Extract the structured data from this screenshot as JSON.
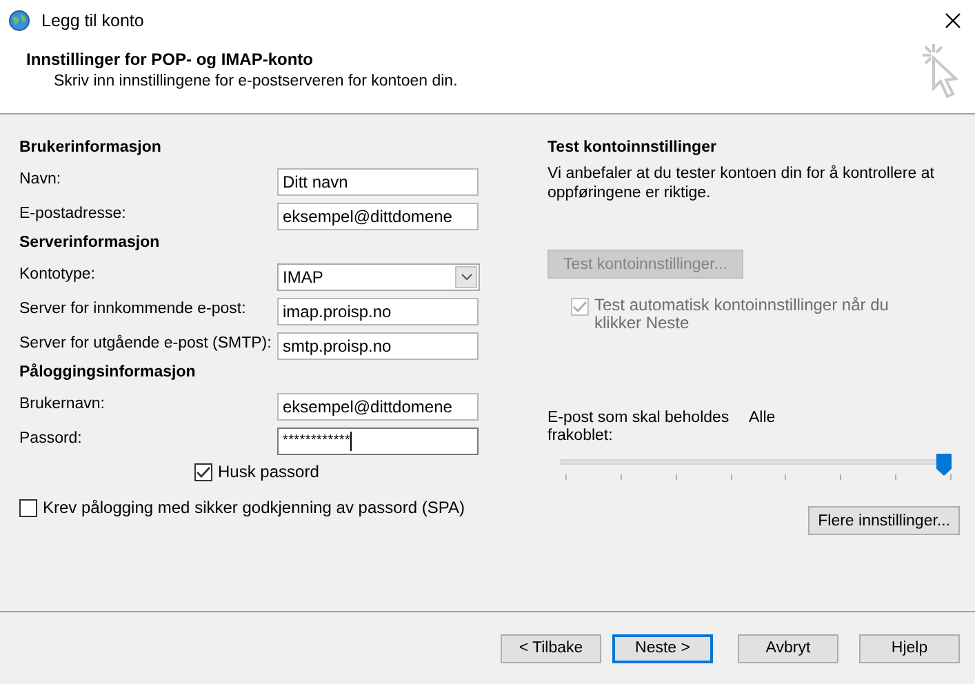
{
  "window": {
    "title": "Legg til konto"
  },
  "header": {
    "title": "Innstillinger for POP- og IMAP-konto",
    "subtitle": "Skriv inn innstillingene for e-postserveren for kontoen din."
  },
  "sections": [
    {
      "heading": "Brukerinformasjon",
      "fields": [
        {
          "kind": "text",
          "label": "Navn:",
          "value": "Ditt navn"
        },
        {
          "kind": "text",
          "label": "E-postadresse:",
          "value": "eksempel@dittdomene"
        }
      ]
    },
    {
      "heading": "Serverinformasjon",
      "fields": [
        {
          "kind": "select",
          "label": "Kontotype:",
          "value": "IMAP"
        },
        {
          "kind": "text",
          "label": "Server for innkommende e-post:",
          "value": "imap.proisp.no"
        },
        {
          "kind": "text",
          "label": "Server for utgående e-post (SMTP):",
          "value": "smtp.proisp.no"
        }
      ]
    },
    {
      "heading": "Påloggingsinformasjon",
      "fields": [
        {
          "kind": "text",
          "label": "Brukernavn:",
          "value": "eksempel@dittdomene"
        },
        {
          "kind": "password",
          "label": "Passord:",
          "value": "************",
          "focused": true
        },
        {
          "kind": "checkbox",
          "label": "Husk passord",
          "checked": true
        }
      ]
    }
  ],
  "spa": {
    "label": "Krev pålogging med sikker godkjenning av passord (SPA)",
    "checked": false
  },
  "test": {
    "heading": "Test kontoinnstillinger",
    "description": "Vi anbefaler at du tester kontoen din for å kontrollere at oppføringene er riktige.",
    "button": {
      "label": "Test kontoinnstillinger...",
      "disabled": true
    },
    "auto_test": {
      "label": "Test automatisk kontoinnstillinger når du klikker Neste",
      "checked": true,
      "disabled": true
    }
  },
  "offline": {
    "label": "E-post som skal beholdes frakoblet:",
    "value": "Alle",
    "level": 1
  },
  "more_button": {
    "label": "Flere innstillinger..."
  },
  "buttons": [
    {
      "label": "< Tilbake",
      "selected": false
    },
    {
      "label": "Neste >",
      "selected": true
    },
    {
      "label": "Avbryt",
      "selected": false
    },
    {
      "label": "Hjelp",
      "selected": false
    }
  ]
}
